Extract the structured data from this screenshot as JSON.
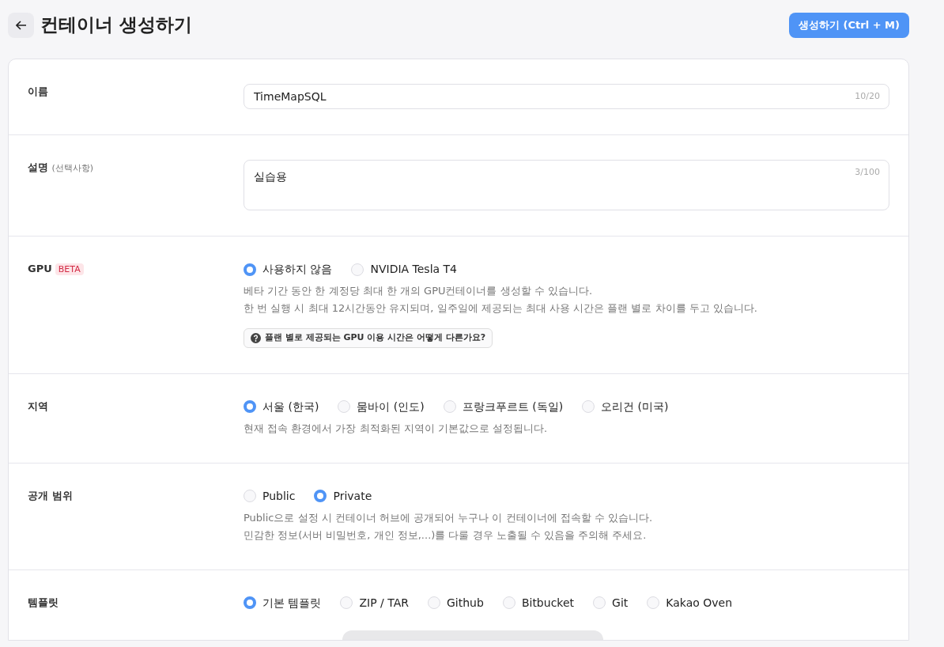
{
  "header": {
    "title": "컨테이너 생성하기",
    "create_button": "생성하기 (Ctrl + M)"
  },
  "sections": [
    {
      "kind": "text",
      "label": "이름",
      "value": "TimeMapSQL",
      "counter": "10/20"
    },
    {
      "kind": "textarea",
      "label": "설명",
      "label_note": "(선택사항)",
      "value": "실습용",
      "counter": "3/100"
    },
    {
      "kind": "radio",
      "label": "GPU",
      "badge": "BETA",
      "options": [
        {
          "label": "사용하지 않음",
          "selected": true
        },
        {
          "label": "NVIDIA Tesla T4",
          "selected": false
        }
      ],
      "help": [
        "베타 기간 동안 한 계정당 최대 한 개의 GPU컨테이너를 생성할 수 있습니다.",
        "한 번 실행 시 최대 12시간동안 유지되며, 일주일에 제공되는 최대 사용 시간은 플랜 별로 차이를 두고 있습니다."
      ],
      "info_button": "플랜 별로 제공되는 GPU 이용 시간은 어떻게 다른가요?"
    },
    {
      "kind": "radio",
      "label": "지역",
      "options": [
        {
          "label": "서울 (한국)",
          "selected": true
        },
        {
          "label": "뭄바이 (인도)",
          "selected": false
        },
        {
          "label": "프랑크푸르트 (독일)",
          "selected": false
        },
        {
          "label": "오리건 (미국)",
          "selected": false
        }
      ],
      "help": [
        "현재 접속 환경에서 가장 최적화된 지역이 기본값으로 설정됩니다."
      ]
    },
    {
      "kind": "radio",
      "label": "공개 범위",
      "options": [
        {
          "label": "Public",
          "selected": false
        },
        {
          "label": "Private",
          "selected": true
        }
      ],
      "help": [
        "Public으로 설정 시 컨테이너 허브에 공개되어 누구나 이 컨테이너에 접속할 수 있습니다.",
        "민감한 정보(서버 비밀번호, 개인 정보,...)를 다룰 경우 노출될 수 있음을 주의해 주세요."
      ]
    },
    {
      "kind": "radio",
      "label": "템플릿",
      "options": [
        {
          "label": "기본 템플릿",
          "selected": true
        },
        {
          "label": "ZIP / TAR",
          "selected": false
        },
        {
          "label": "Github",
          "selected": false
        },
        {
          "label": "Bitbucket",
          "selected": false
        },
        {
          "label": "Git",
          "selected": false
        },
        {
          "label": "Kakao Oven",
          "selected": false
        }
      ],
      "partial_panel": true
    }
  ]
}
